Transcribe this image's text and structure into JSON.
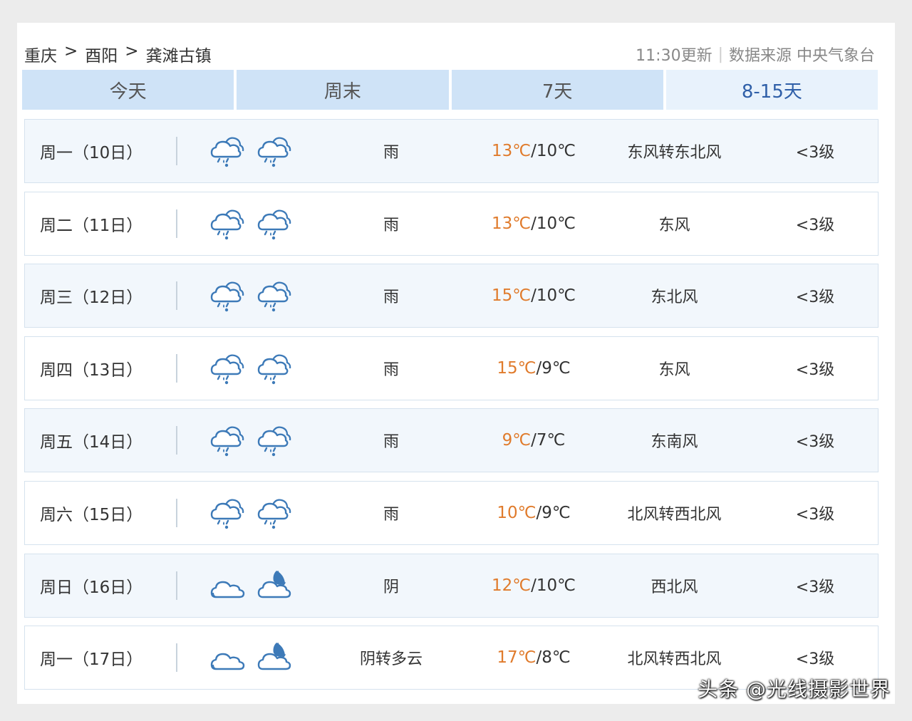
{
  "breadcrumb": [
    "重庆",
    "酉阳",
    "龚滩古镇"
  ],
  "breadcrumb_sep": ">",
  "update_time": "11:30更新",
  "source": "数据来源 中央气象台",
  "tabs": [
    {
      "label": "今天",
      "active": false
    },
    {
      "label": "周末",
      "active": false
    },
    {
      "label": "7天",
      "active": false
    },
    {
      "label": "8-15天",
      "active": true
    }
  ],
  "forecast": [
    {
      "day": "周一（10日）",
      "icons": [
        "cloud-rain-icon",
        "cloud-rain-icon"
      ],
      "condition": "雨",
      "high": "13℃",
      "low": "10℃",
      "wind": "东风转东北风",
      "level": "<3级"
    },
    {
      "day": "周二（11日）",
      "icons": [
        "cloud-rain-icon",
        "cloud-rain-icon"
      ],
      "condition": "雨",
      "high": "13℃",
      "low": "10℃",
      "wind": "东风",
      "level": "<3级"
    },
    {
      "day": "周三（12日）",
      "icons": [
        "cloud-rain-icon",
        "cloud-rain-icon"
      ],
      "condition": "雨",
      "high": "15℃",
      "low": "10℃",
      "wind": "东北风",
      "level": "<3级"
    },
    {
      "day": "周四（13日）",
      "icons": [
        "cloud-rain-icon",
        "cloud-rain-icon"
      ],
      "condition": "雨",
      "high": "15℃",
      "low": "9℃",
      "wind": "东风",
      "level": "<3级"
    },
    {
      "day": "周五（14日）",
      "icons": [
        "cloud-rain-icon",
        "cloud-rain-icon"
      ],
      "condition": "雨",
      "high": "9℃",
      "low": "7℃",
      "wind": "东南风",
      "level": "<3级"
    },
    {
      "day": "周六（15日）",
      "icons": [
        "cloud-rain-icon",
        "cloud-rain-icon"
      ],
      "condition": "雨",
      "high": "10℃",
      "low": "9℃",
      "wind": "北风转西北风",
      "level": "<3级"
    },
    {
      "day": "周日（16日）",
      "icons": [
        "overcast-icon",
        "cloud-moon-icon"
      ],
      "condition": "阴",
      "high": "12℃",
      "low": "10℃",
      "wind": "西北风",
      "level": "<3级"
    },
    {
      "day": "周一（17日）",
      "icons": [
        "overcast-icon",
        "cloud-moon-icon"
      ],
      "condition": "阴转多云",
      "high": "17℃",
      "low": "8℃",
      "wind": "北风转西北风",
      "level": "<3级"
    }
  ],
  "colors": {
    "accent": "#2f5fa8",
    "high_temp": "#e07b2c",
    "tab_bg": "#cfe3f7",
    "icon": "#3d7ab8"
  },
  "watermark": "头条 @光线摄影世界"
}
